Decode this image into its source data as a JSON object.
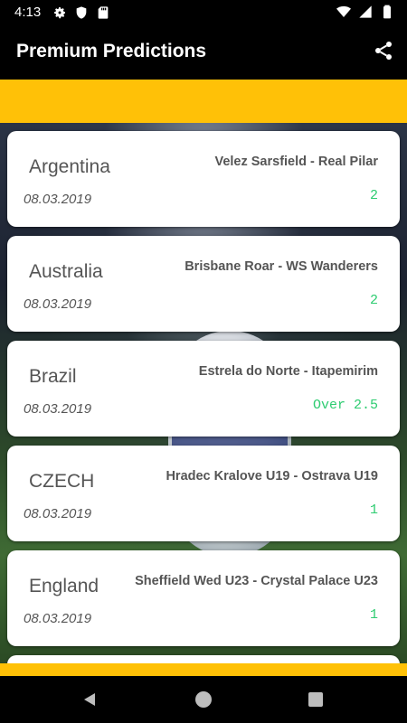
{
  "status_bar": {
    "time": "4:13"
  },
  "app_bar": {
    "title": "Premium Predictions"
  },
  "predictions": [
    {
      "country": "Argentina",
      "match": "Velez Sarsfield - Real Pilar",
      "date": "08.03.2019",
      "tip": "2"
    },
    {
      "country": "Australia",
      "match": "Brisbane Roar - WS Wanderers",
      "date": "08.03.2019",
      "tip": "2"
    },
    {
      "country": "Brazil",
      "match": "Estrela do Norte - Itapemirim",
      "date": "08.03.2019",
      "tip": "Over 2.5"
    },
    {
      "country": "CZECH",
      "match": "Hradec Kralove U19 - Ostrava U19",
      "date": "08.03.2019",
      "tip": "1"
    },
    {
      "country": "England",
      "match": "Sheffield Wed U23 - Crystal Palace U23",
      "date": "08.03.2019",
      "tip": "1"
    }
  ],
  "colors": {
    "accent": "#ffc107",
    "tip": "#2ecc71",
    "bar": "#000000"
  },
  "icons": {
    "status_left": [
      "settings-icon",
      "shield-icon",
      "sd-card-icon"
    ],
    "status_right": [
      "wifi-icon",
      "signal-icon",
      "battery-icon"
    ],
    "app_bar": "share-icon",
    "nav": [
      "back-icon",
      "home-icon",
      "recents-icon"
    ]
  }
}
